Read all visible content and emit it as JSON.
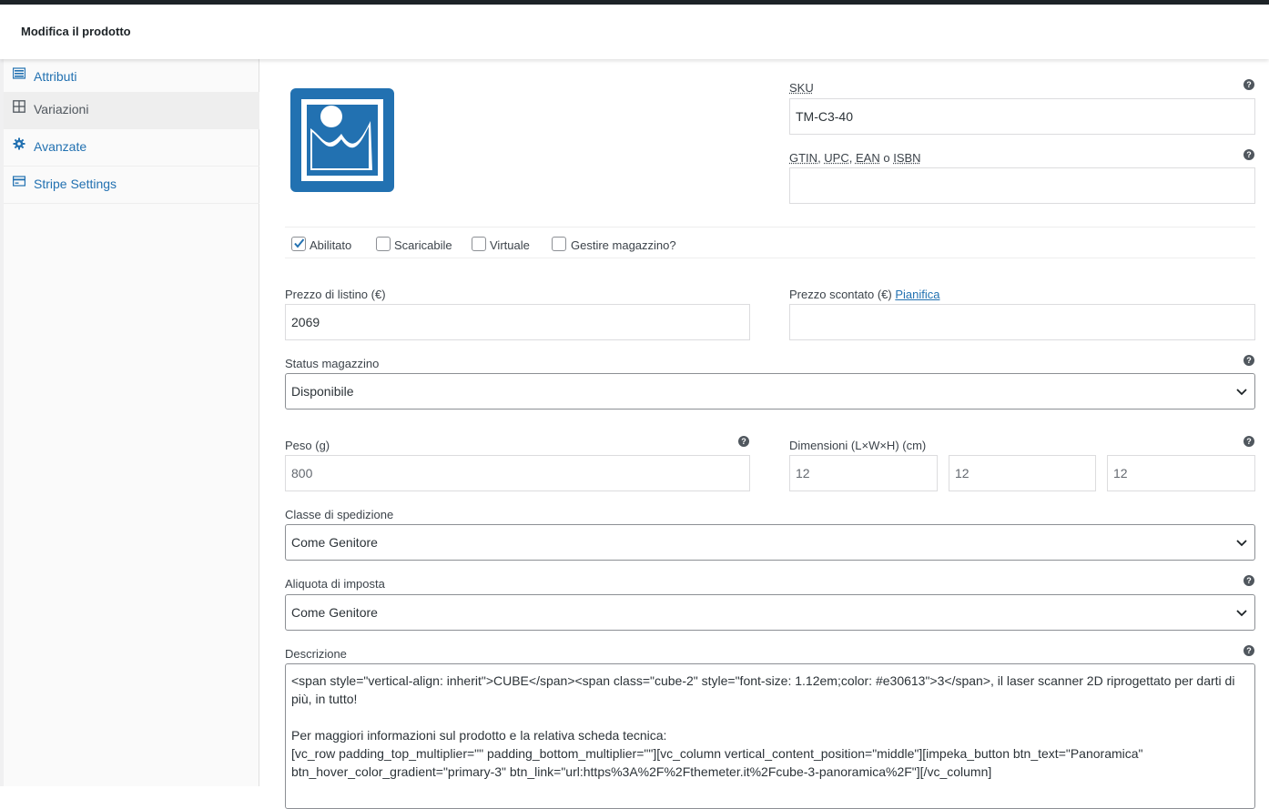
{
  "header": {
    "title": "Modifica il prodotto"
  },
  "sidebar": {
    "items": [
      {
        "label": "Attributi",
        "icon": "list-icon",
        "active": false
      },
      {
        "label": "Variazioni",
        "icon": "grid-icon",
        "active": true
      },
      {
        "label": "Avanzate",
        "icon": "gear-icon",
        "active": false
      },
      {
        "label": "Stripe Settings",
        "icon": "card-icon",
        "active": false
      }
    ]
  },
  "image": {
    "icon": "image-placeholder-icon",
    "color": "#2271b1"
  },
  "help_icon_glyph": "?",
  "sku": {
    "label": "SKU",
    "value": "TM-C3-40"
  },
  "gtin": {
    "label_parts": [
      "GTIN",
      "UPC",
      "EAN",
      "o",
      "ISBN"
    ],
    "value": ""
  },
  "options": {
    "enabled": {
      "label": "Abilitato",
      "checked": true
    },
    "downloadable": {
      "label": "Scaricabile",
      "checked": false
    },
    "virtual": {
      "label": "Virtuale",
      "checked": false
    },
    "manage_stock": {
      "label": "Gestire magazzino?",
      "checked": false
    }
  },
  "regular_price": {
    "label": "Prezzo di listino (€)",
    "value": "2069"
  },
  "sale_price": {
    "label": "Prezzo scontato (€)",
    "link": "Pianifica",
    "value": ""
  },
  "stock_status": {
    "label": "Status magazzino",
    "value": "Disponibile"
  },
  "weight": {
    "label": "Peso (g)",
    "placeholder": "800"
  },
  "dimensions": {
    "label": "Dimensioni (L×W×H) (cm)",
    "length": "12",
    "width": "12",
    "height": "12"
  },
  "shipping_class": {
    "label": "Classe di spedizione",
    "value": "Come Genitore"
  },
  "tax_class": {
    "label": "Aliquota di imposta",
    "value": "Come Genitore"
  },
  "description": {
    "label": "Descrizione",
    "line1": "<span style=\"vertical-align: inherit\">CUBE</span><span class=\"cube-2\" style=\"font-size: 1.12em;color: #e30613\">3</span>, il laser scanner 2D riprogettato per darti di più, in tutto!",
    "line2": "",
    "line3": "Per maggiori informazioni sul prodotto e la relativa scheda tecnica:",
    "line4": "[vc_row padding_top_multiplier=\"\" padding_bottom_multiplier=\"\"][vc_column vertical_content_position=\"middle\"][impeka_button btn_text=\"Panoramica\" btn_hover_color_gradient=\"primary-3\" btn_link=\"url:https%3A%2F%2Fthemeter.it%2Fcube-3-panoramica%2F\"][/vc_column]"
  }
}
